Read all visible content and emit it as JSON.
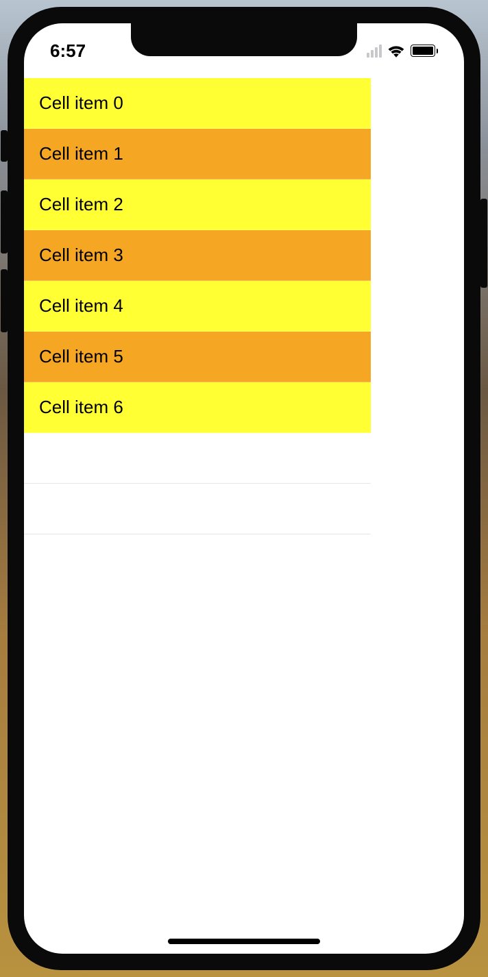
{
  "status_bar": {
    "time": "6:57"
  },
  "table": {
    "items": [
      {
        "label": "Cell item 0",
        "color": "yellow"
      },
      {
        "label": "Cell item 1",
        "color": "orange"
      },
      {
        "label": "Cell item 2",
        "color": "yellow"
      },
      {
        "label": "Cell item 3",
        "color": "orange"
      },
      {
        "label": "Cell item 4",
        "color": "yellow"
      },
      {
        "label": "Cell item 5",
        "color": "orange"
      },
      {
        "label": "Cell item 6",
        "color": "yellow"
      }
    ]
  },
  "colors": {
    "yellow": "#ffff33",
    "orange": "#f5a623"
  }
}
